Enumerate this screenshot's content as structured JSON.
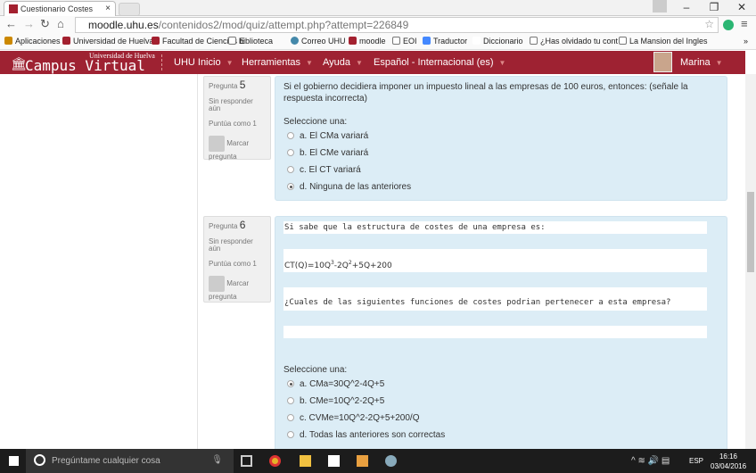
{
  "browser": {
    "tab_title": "Cuestionario Costes",
    "url_host": "moodle.uhu.es",
    "url_path": "/contenidos2/mod/quiz/attempt.php?attempt=226849",
    "bookmarks": [
      "Aplicaciones",
      "Universidad de Huelva",
      "Facultad de Ciencias E",
      "biblioteca",
      "Correo UHU",
      "moodle",
      "EOI",
      "Traductor",
      "Diccionario",
      "¿Has olvidado tu cont",
      "La Mansion del Ingles"
    ],
    "more": "»"
  },
  "nav": {
    "logo_small": "Universidad de Huelva",
    "logo_main": "Campus Virtual",
    "menu": [
      "UHU Inicio",
      "Herramientas",
      "Ayuda",
      "Español - Internacional (es)"
    ],
    "user": "Marina"
  },
  "questions": [
    {
      "label": "Pregunta",
      "number": "5",
      "status": "Sin responder aún",
      "score": "Puntúa como 1",
      "flag": "Marcar pregunta",
      "text": "Si el gobierno decidiera imponer un impuesto lineal a las empresas de 100 euros, entonces: (señale la respuesta incorrecta)",
      "prompt": "Seleccione una:",
      "options": [
        "a. El CMa variará",
        "b. El CMe variará",
        "c. El CT variará",
        "d. Ninguna de las anteriores"
      ],
      "selected": 3
    },
    {
      "label": "Pregunta",
      "number": "6",
      "status": "Sin responder aún",
      "score": "Puntúa como 1",
      "flag": "Marcar pregunta",
      "text1": "Si sabe que la estructura de costes de una empresa es:",
      "formula_pre": "CT(Q)=10Q",
      "exp1": "3",
      "formula_mid": "-2Q",
      "exp2": "2",
      "formula_post": "+5Q+200",
      "text2": "¿Cuales de las siguientes funciones de costes podrian pertenecer a esta empresa?",
      "prompt": "Seleccione una:",
      "options": [
        "a. CMa=30Q^2-4Q+5",
        "b. CMe=10Q^2-2Q+5",
        "c. CVMe=10Q^2-2Q+5+200/Q",
        "d. Todas las anteriores son correctas"
      ],
      "selected": 0
    }
  ],
  "taskbar": {
    "search_placeholder": "Pregúntame cualquier cosa",
    "lang": "ESP",
    "time": "16:16",
    "date": "03/04/2016"
  }
}
